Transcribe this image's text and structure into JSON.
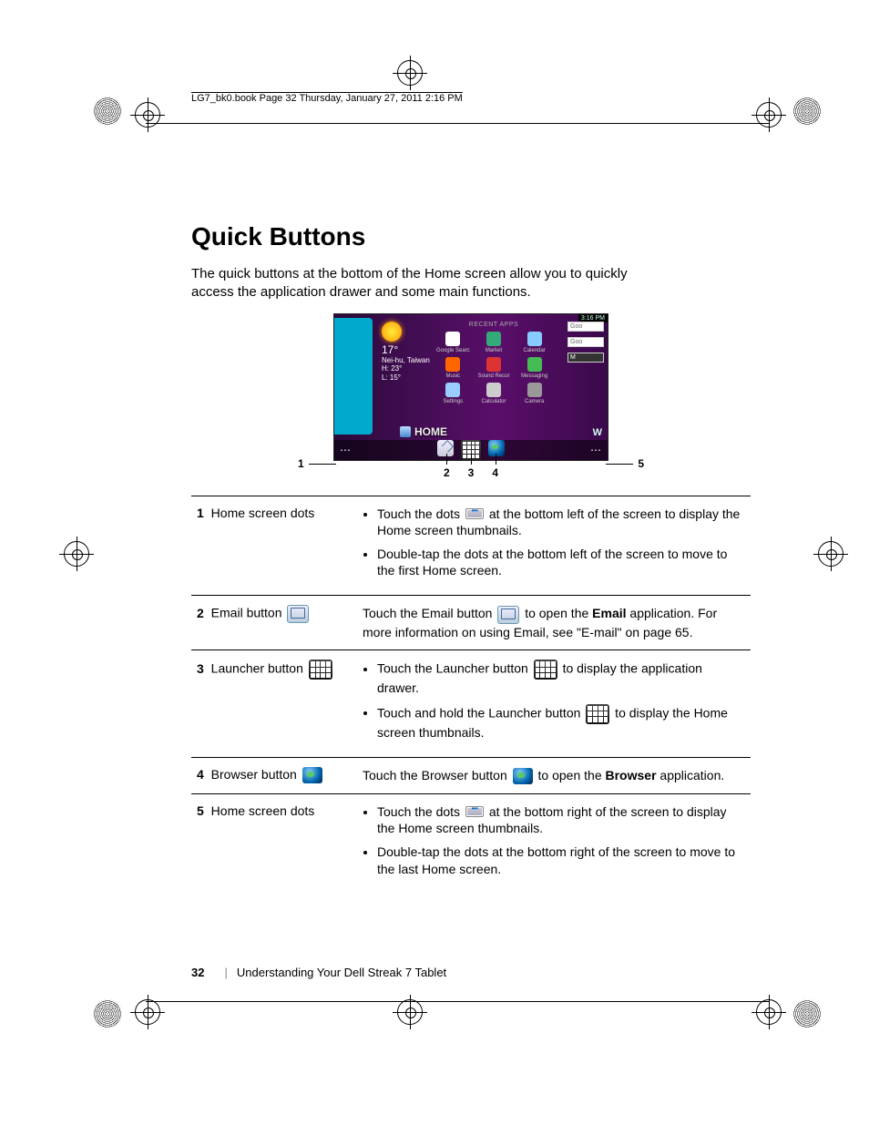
{
  "header": "LG7_bk0.book  Page 32  Thursday, January 27, 2011  2:16 PM",
  "title": "Quick Buttons",
  "intro": "The quick buttons at the bottom of the Home screen allow you to quickly access the application drawer and some main functions.",
  "screenshot": {
    "status": "3:16 PM",
    "weather": {
      "temp": "17°",
      "loc": "Nei-hu, Taiwan",
      "hi": "H:  23°",
      "lo": "L:   15°"
    },
    "recent_label": "RECENT APPS",
    "recent": [
      {
        "label": "Google Searc",
        "color": "#fff"
      },
      {
        "label": "Market",
        "color": "#3a7"
      },
      {
        "label": "Calendar",
        "color": "#8cf"
      },
      {
        "label": "Music",
        "color": "#f60"
      },
      {
        "label": "Sound Recor",
        "color": "#d33"
      },
      {
        "label": "Messaging",
        "color": "#4b5"
      },
      {
        "label": "Settings",
        "color": "#9cf"
      },
      {
        "label": "Calculator",
        "color": "#ccc"
      },
      {
        "label": "Camera",
        "color": "#999"
      }
    ],
    "google_hint": "Goo",
    "home_label": "HOME",
    "w_peek": "W"
  },
  "callouts": {
    "c1": "1",
    "c5": "5",
    "c2": "2",
    "c3": "3",
    "c4": "4"
  },
  "rows": [
    {
      "num": "1",
      "label": "Home screen dots",
      "icon": null,
      "bullets": [
        "Touch the dots {dots} at the bottom left of the screen to display the Home screen thumbnails.",
        "Double-tap the dots at the bottom left of the screen to move to the first Home screen."
      ]
    },
    {
      "num": "2",
      "label": "Email button",
      "icon": "mail",
      "plain": "Touch the Email button {mail} to open the <b>Email</b> application. For more information on using Email, see \"E-mail\" on page 65."
    },
    {
      "num": "3",
      "label": "Launcher button",
      "icon": "grid",
      "bullets": [
        "Touch the Launcher button {grid} to display the application drawer.",
        "Touch and hold the Launcher button {grid} to display the Home screen thumbnails."
      ]
    },
    {
      "num": "4",
      "label": "Browser button",
      "icon": "globe",
      "plain": "Touch the Browser button {globe} to open the <b>Browser</b> application."
    },
    {
      "num": "5",
      "label": "Home screen dots",
      "icon": null,
      "bullets": [
        "Touch the dots {dots} at the bottom right of the screen to display the Home screen thumbnails.",
        "Double-tap the dots at the bottom right of the screen to move to the last Home screen."
      ]
    }
  ],
  "footer": {
    "page": "32",
    "section": "Understanding Your Dell Streak 7 Tablet"
  }
}
